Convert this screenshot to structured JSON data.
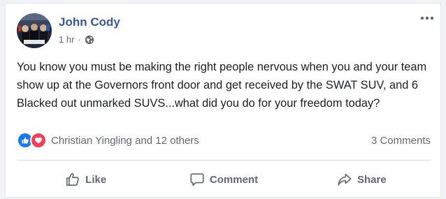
{
  "post": {
    "author": "John Cody",
    "time": "1 hr",
    "separator": "·",
    "privacy_icon": "globe-icon",
    "more_icon": "more-options-icon",
    "text": "You know you must be making the right people nervous when you and your team show up at the Governors front door and get received by the SWAT SUV, and 6 Blacked out unmarked SUVS...what did you do for your freedom today?",
    "reactions": {
      "icons": [
        "like-reaction-icon",
        "love-reaction-icon"
      ],
      "summary": "Christian Yingling and 12 others"
    },
    "comments_count": "3 Comments",
    "actions": {
      "like": "Like",
      "comment": "Comment",
      "share": "Share"
    }
  },
  "colors": {
    "author": "#385898",
    "like_blue": "#1877f2",
    "love_red": "#f33e58",
    "secondary_text": "#65676b",
    "action_text": "#606770"
  }
}
